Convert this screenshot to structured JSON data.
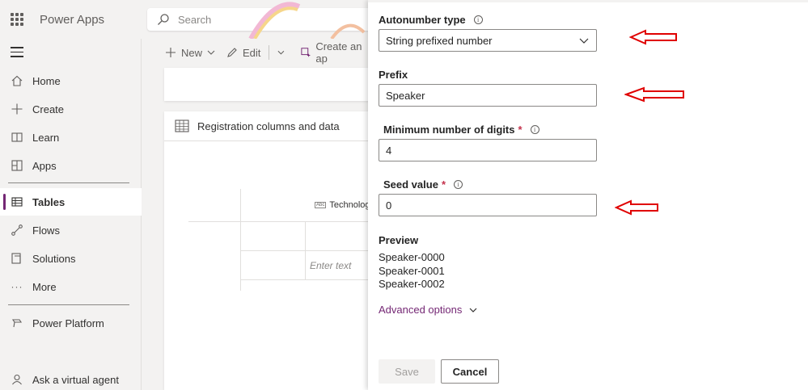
{
  "app": {
    "title": "Power Apps"
  },
  "search": {
    "placeholder": "Search"
  },
  "sidebar": {
    "items": [
      {
        "label": "Home",
        "icon": "home-icon"
      },
      {
        "label": "Create",
        "icon": "plus-icon"
      },
      {
        "label": "Learn",
        "icon": "book-icon"
      },
      {
        "label": "Apps",
        "icon": "apps-icon"
      },
      {
        "label": "Tables",
        "icon": "table-icon",
        "active": true
      },
      {
        "label": "Flows",
        "icon": "flow-icon"
      },
      {
        "label": "Solutions",
        "icon": "solutions-icon"
      },
      {
        "label": "More",
        "icon": "more-icon"
      },
      {
        "label": "Power Platform",
        "icon": "power-platform-icon"
      },
      {
        "label": "Ask a virtual agent",
        "icon": "virtual-agent-icon"
      }
    ]
  },
  "commandbar": {
    "new_label": "New",
    "edit_label": "Edit",
    "create_label": "Create an ap"
  },
  "table_card": {
    "title": "Registration columns and data",
    "column_header": "Technolog",
    "cell_placeholder": "Enter text"
  },
  "panel": {
    "autonumber_type_label": "Autonumber type",
    "autonumber_type_value": "String prefixed number",
    "prefix_label": "Prefix",
    "prefix_value": "Speaker",
    "min_digits_label": "Minimum number of digits",
    "min_digits_value": "4",
    "seed_label": "Seed value",
    "seed_value": "0",
    "required_marker": "*",
    "preview_label": "Preview",
    "preview_values": [
      "Speaker-0000",
      "Speaker-0001",
      "Speaker-0002"
    ],
    "advanced_label": "Advanced options",
    "save_label": "Save",
    "cancel_label": "Cancel"
  },
  "colors": {
    "accent": "#742774",
    "required": "#c4314b",
    "annotation_arrow": "#e00000"
  }
}
